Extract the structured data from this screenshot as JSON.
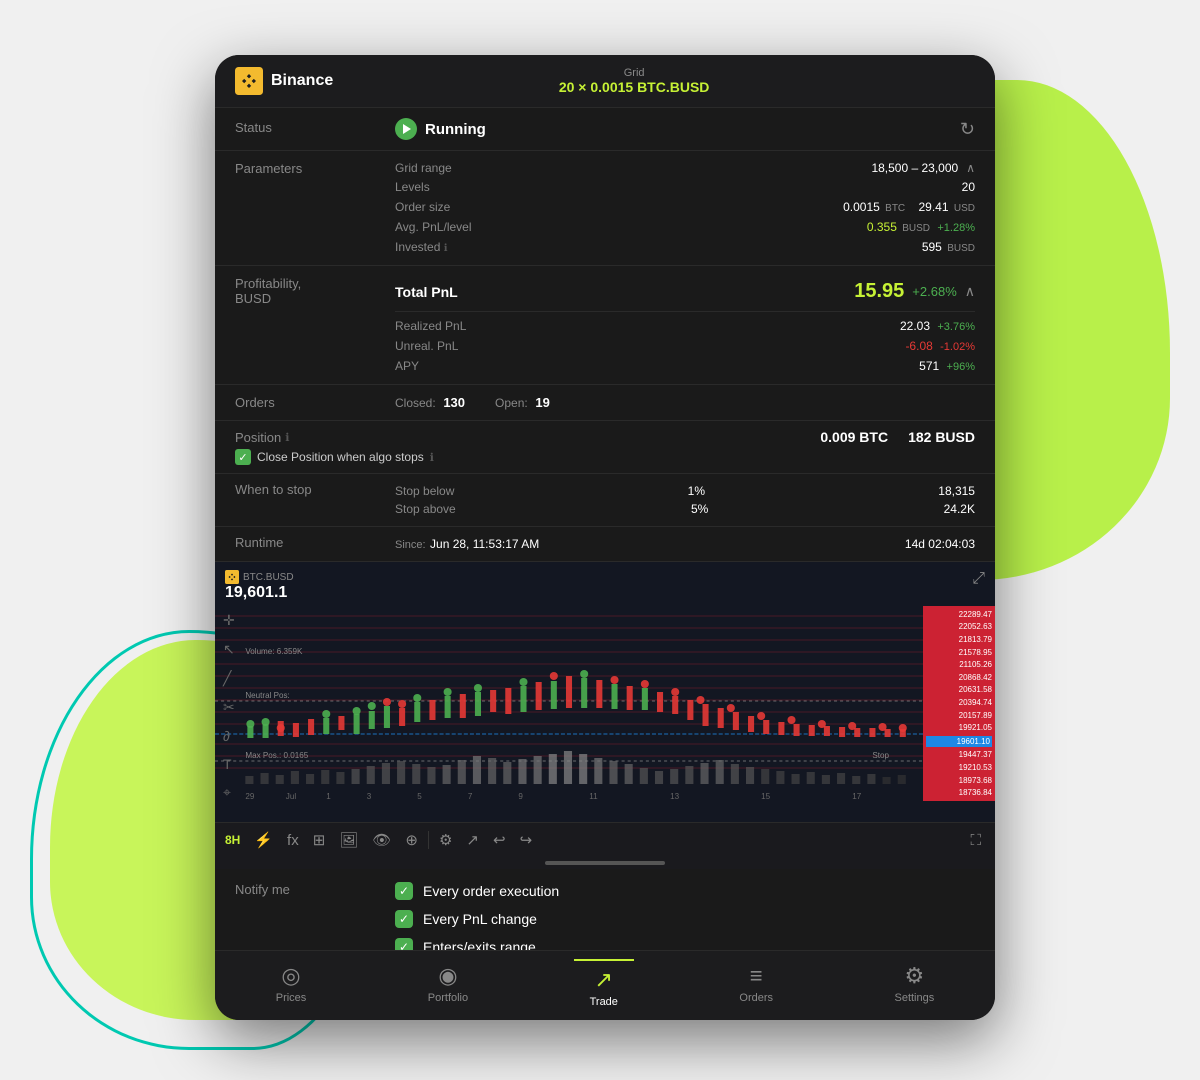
{
  "background": {
    "blob_colors": [
      "#b8f04a",
      "#c8f55a"
    ],
    "teal_outline": "#00c9b1"
  },
  "header": {
    "exchange": "Binance",
    "grid_label": "Grid",
    "grid_value": "20 × 0.0015 BTC.BUSD"
  },
  "status": {
    "label": "Status",
    "value": "Running",
    "refresh_icon": "↻"
  },
  "parameters": {
    "label": "Parameters",
    "grid_range_label": "Grid range",
    "grid_range_value": "18,500 – 23,000",
    "levels_label": "Levels",
    "levels_value": "20",
    "order_size_label": "Order size",
    "order_size_value": "0.0015",
    "order_size_unit": "BTC",
    "order_size_usd": "29.41",
    "order_size_usd_unit": "USD",
    "avg_pnl_label": "Avg. PnL/level",
    "avg_pnl_value": "0.355",
    "avg_pnl_unit": "BUSD",
    "avg_pnl_pct": "+1.28%",
    "invested_label": "Invested",
    "invested_value": "595",
    "invested_unit": "BUSD"
  },
  "profitability": {
    "label": "Profitability,",
    "sublabel": "BUSD",
    "total_pnl_label": "Total PnL",
    "total_pnl_value": "15.95",
    "total_pnl_pct": "+2.68%",
    "realized_label": "Realized PnL",
    "realized_value": "22.03",
    "realized_pct": "+3.76%",
    "unrealized_label": "Unreal. PnL",
    "unrealized_value": "-6.08",
    "unrealized_pct": "-1.02%",
    "apy_label": "APY",
    "apy_value": "571",
    "apy_pct": "+96%"
  },
  "orders": {
    "label": "Orders",
    "closed_label": "Closed:",
    "closed_value": "130",
    "open_label": "Open:",
    "open_value": "19"
  },
  "position": {
    "label": "Position",
    "info_icon": "ℹ",
    "btc_value": "0.009 BTC",
    "busd_value": "182 BUSD",
    "close_position_text": "Close Position when algo stops"
  },
  "when_to_stop": {
    "label": "When to stop",
    "stop_below_label": "Stop below",
    "stop_below_pct": "1%",
    "stop_below_value": "18,315",
    "stop_above_label": "Stop above",
    "stop_above_pct": "5%",
    "stop_above_value": "24.2K"
  },
  "runtime": {
    "label": "Runtime",
    "since_label": "Since:",
    "since_value": "Jun 28, 11:53:17 AM",
    "duration": "14d 02:04:03"
  },
  "chart": {
    "symbol": "BTC.BUSD",
    "price": "19,601.1",
    "timeframe": "8H",
    "volume_label": "Volume: 6.359K",
    "neutral_pos_label": "Neutral Pos:",
    "max_pos_label": "Max Pos.: 0.0165",
    "expand_icon": "⤢",
    "price_levels": [
      "22289.47",
      "22052.63",
      "21813.79",
      "21578.95",
      "21105.26",
      "20868.42",
      "20631.58",
      "20394.74",
      "20157.89",
      "19921.05",
      "19601.10",
      "19447.37",
      "19210.53",
      "18973.68",
      "18736.84"
    ],
    "x_labels": [
      "29",
      "Jul",
      "1",
      "3",
      "5",
      "7",
      "9",
      "11",
      "13",
      "15",
      "17"
    ],
    "stop_label": "Stop"
  },
  "chart_toolbar": {
    "timeframe": "8H",
    "icons": [
      "⚙",
      "⬆",
      "↩",
      "↪"
    ],
    "fullscreen_icon": "⛶"
  },
  "notify": {
    "label": "Notify me",
    "items": [
      "Every order execution",
      "Every PnL change",
      "Enters/exits range"
    ]
  },
  "bottom_nav": {
    "items": [
      {
        "icon": "◎",
        "label": "Prices",
        "active": false
      },
      {
        "icon": "◉",
        "label": "Portfolio",
        "active": false
      },
      {
        "icon": "↗",
        "label": "Trade",
        "active": true
      },
      {
        "icon": "≡",
        "label": "Orders",
        "active": false
      },
      {
        "icon": "⚙",
        "label": "Settings",
        "active": false
      }
    ]
  }
}
